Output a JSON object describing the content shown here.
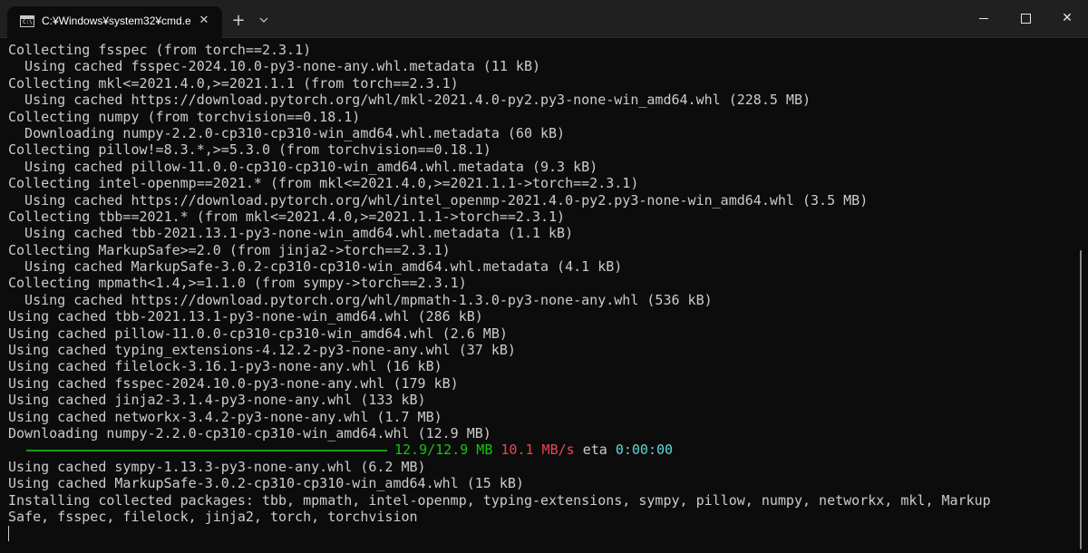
{
  "window": {
    "tab_title": "C:¥Windows¥system32¥cmd.e",
    "tab_icon_text": "C:\\"
  },
  "terminal": {
    "lines": [
      "Collecting fsspec (from torch==2.3.1)",
      "  Using cached fsspec-2024.10.0-py3-none-any.whl.metadata (11 kB)",
      "Collecting mkl<=2021.4.0,>=2021.1.1 (from torch==2.3.1)",
      "  Using cached https://download.pytorch.org/whl/mkl-2021.4.0-py2.py3-none-win_amd64.whl (228.5 MB)",
      "Collecting numpy (from torchvision==0.18.1)",
      "  Downloading numpy-2.2.0-cp310-cp310-win_amd64.whl.metadata (60 kB)",
      "Collecting pillow!=8.3.*,>=5.3.0 (from torchvision==0.18.1)",
      "  Using cached pillow-11.0.0-cp310-cp310-win_amd64.whl.metadata (9.3 kB)",
      "Collecting intel-openmp==2021.* (from mkl<=2021.4.0,>=2021.1.1->torch==2.3.1)",
      "  Using cached https://download.pytorch.org/whl/intel_openmp-2021.4.0-py2.py3-none-win_amd64.whl (3.5 MB)",
      "Collecting tbb==2021.* (from mkl<=2021.4.0,>=2021.1.1->torch==2.3.1)",
      "  Using cached tbb-2021.13.1-py3-none-win_amd64.whl.metadata (1.1 kB)",
      "Collecting MarkupSafe>=2.0 (from jinja2->torch==2.3.1)",
      "  Using cached MarkupSafe-3.0.2-cp310-cp310-win_amd64.whl.metadata (4.1 kB)",
      "Collecting mpmath<1.4,>=1.1.0 (from sympy->torch==2.3.1)",
      "  Using cached https://download.pytorch.org/whl/mpmath-1.3.0-py3-none-any.whl (536 kB)",
      "Using cached tbb-2021.13.1-py3-none-win_amd64.whl (286 kB)",
      "Using cached pillow-11.0.0-cp310-cp310-win_amd64.whl (2.6 MB)",
      "Using cached typing_extensions-4.12.2-py3-none-any.whl (37 kB)",
      "Using cached filelock-3.16.1-py3-none-any.whl (16 kB)",
      "Using cached fsspec-2024.10.0-py3-none-any.whl (179 kB)",
      "Using cached jinja2-3.1.4-py3-none-any.whl (133 kB)",
      "Using cached networkx-3.4.2-py3-none-any.whl (1.7 MB)",
      "Downloading numpy-2.2.0-cp310-cp310-win_amd64.whl (12.9 MB)"
    ],
    "progress": {
      "fraction": 1.0,
      "size": "12.9/12.9 MB",
      "speed": "10.1 MB/s",
      "eta_label": "eta",
      "eta": "0:00:00"
    },
    "lines_after": [
      "Using cached sympy-1.13.3-py3-none-any.whl (6.2 MB)",
      "Using cached MarkupSafe-3.0.2-cp310-cp310-win_amd64.whl (15 kB)",
      "Installing collected packages: tbb, mpmath, intel-openmp, typing-extensions, sympy, pillow, numpy, networkx, mkl, Markup",
      "Safe, fsspec, filelock, jinja2, torch, torchvision"
    ]
  },
  "colors": {
    "background": "#0c0c0c",
    "text": "#cccccc",
    "progress_green": "#13a10e",
    "speed_red": "#e74856",
    "eta_cyan": "#61d6d6"
  }
}
